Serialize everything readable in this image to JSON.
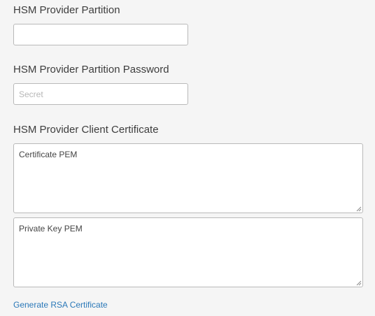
{
  "form": {
    "partition": {
      "label": "HSM Provider Partition",
      "value": "",
      "placeholder": ""
    },
    "partition_password": {
      "label": "HSM Provider Partition Password",
      "value": "",
      "placeholder": "Secret"
    },
    "client_certificate": {
      "label": "HSM Provider Client Certificate",
      "certificate_placeholder": "Certificate PEM",
      "private_key_placeholder": "Private Key PEM"
    },
    "generate_link": "Generate RSA Certificate"
  },
  "colors": {
    "background": "#f5f5f5",
    "link": "#2a78b8",
    "border": "#b9b9b9"
  }
}
